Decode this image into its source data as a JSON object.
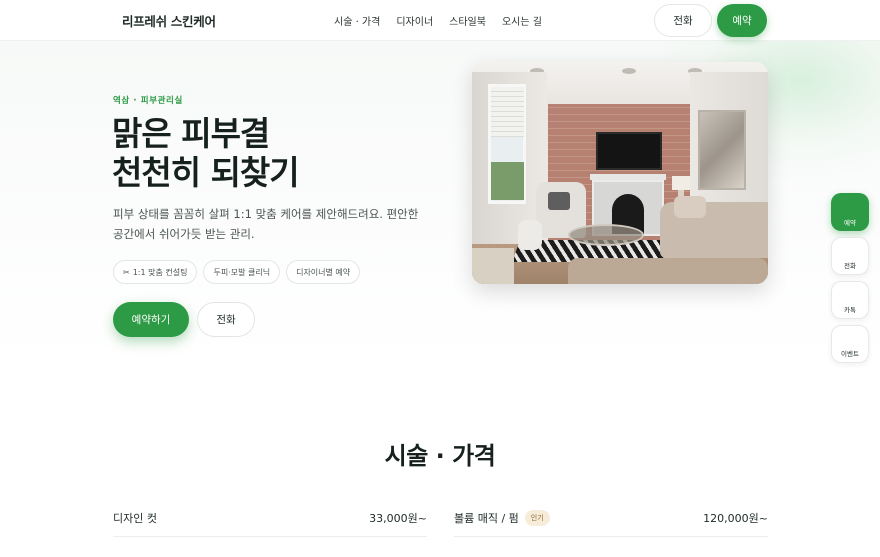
{
  "header": {
    "brand": "리프레쉬 스킨케어",
    "nav": [
      "시술 · 가격",
      "디자이너",
      "스타일북",
      "오시는 길"
    ],
    "call_label": "전화",
    "book_label": "예약"
  },
  "hero": {
    "eyebrow": "역삼 · 피부관리실",
    "headline_line1": "맑은 피부결",
    "headline_line2": "천천히 되찾기",
    "description": "피부 상태를 꼼꼼히 살펴 1:1 맞춤 케어를 제안해드려요. 편안한 공간에서 쉬어가듯 받는 관리.",
    "chips": [
      "1:1 맞춤 컨설팅",
      "두피·모발 클리닉",
      "디자이너별 예약"
    ],
    "chip_icon": "scissors-icon",
    "primary_cta": "예약하기",
    "secondary_cta": "전화"
  },
  "quick_actions": {
    "book": "예약",
    "call": "전화",
    "talk": "카톡",
    "event": "이벤트"
  },
  "services": {
    "title": "시술 · 가격",
    "left": [
      {
        "name": "디자인 컷",
        "price": "33,000원~"
      }
    ],
    "right": [
      {
        "name": "볼륨 매직 / 펌",
        "badge": "인기",
        "price": "120,000원~"
      }
    ]
  },
  "colors": {
    "accent": "#2d9a45",
    "text": "#1e2a26",
    "badge_bg": "#f6ecd9"
  }
}
